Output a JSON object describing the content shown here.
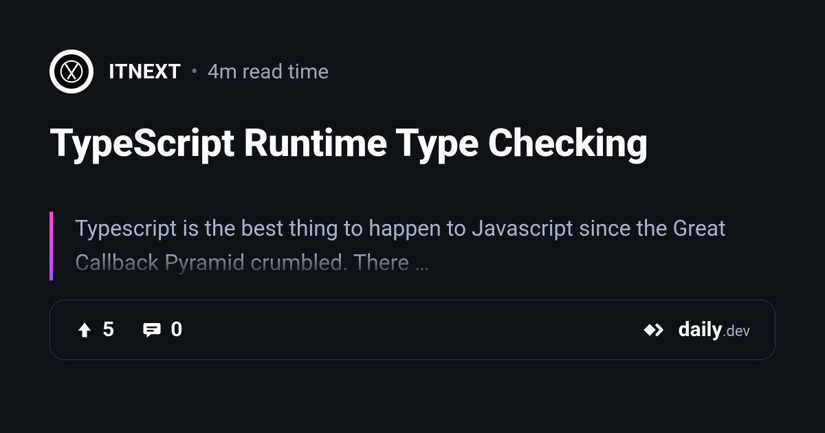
{
  "source": {
    "name": "ITNEXT",
    "read_time": "4m read time",
    "separator": "•"
  },
  "article": {
    "title": "TypeScript Runtime Type Checking",
    "excerpt": "Typescript is the best thing to happen to Javascript since the Great Callback Pyramid crumbled. There …"
  },
  "stats": {
    "upvotes": "5",
    "comments": "0"
  },
  "brand": {
    "name": "daily",
    "suffix": ".dev"
  }
}
